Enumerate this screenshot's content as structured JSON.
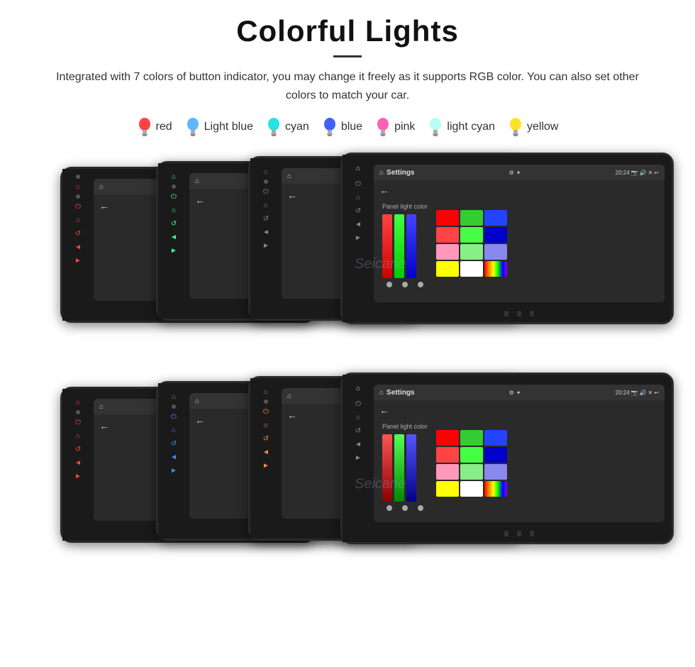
{
  "header": {
    "title": "Colorful Lights",
    "divider": true,
    "description": "Integrated with 7 colors of button indicator, you may change it freely as it supports RGB color. You can also set other colors to match your car."
  },
  "colors": [
    {
      "name": "red",
      "hex": "#ff2222",
      "bulb_color": "#ff2222"
    },
    {
      "name": "Light blue",
      "hex": "#44aaff",
      "bulb_color": "#44aaff"
    },
    {
      "name": "cyan",
      "hex": "#00dddd",
      "bulb_color": "#00dddd"
    },
    {
      "name": "blue",
      "hex": "#2244ff",
      "bulb_color": "#2244ff"
    },
    {
      "name": "pink",
      "hex": "#ff44aa",
      "bulb_color": "#ff44aa"
    },
    {
      "name": "light cyan",
      "hex": "#aaffee",
      "bulb_color": "#aaffee"
    },
    {
      "name": "yellow",
      "hex": "#ffdd00",
      "bulb_color": "#ffdd00"
    }
  ],
  "watermark": "Seicane",
  "panels": {
    "label": "Panel light color",
    "color_grid_top": [
      "#ff0000",
      "#33cc33",
      "#2244ff",
      "#ff3333",
      "#44ff44",
      "#0000dd",
      "#ff99aa",
      "#88ee88",
      "#8888ff",
      "#ffff00",
      "#ffffff",
      "#ff44ff"
    ],
    "color_grid_bottom": [
      "#ff0000",
      "#33cc33",
      "#2244ff",
      "#ff3333",
      "#44ff44",
      "#0000dd",
      "#ff99aa",
      "#88ee88",
      "#8888ff",
      "#ffff00",
      "#ffffff",
      "#ff44ff"
    ]
  },
  "screen": {
    "header_title": "Settings",
    "back_label": "←",
    "time": "20:24"
  }
}
